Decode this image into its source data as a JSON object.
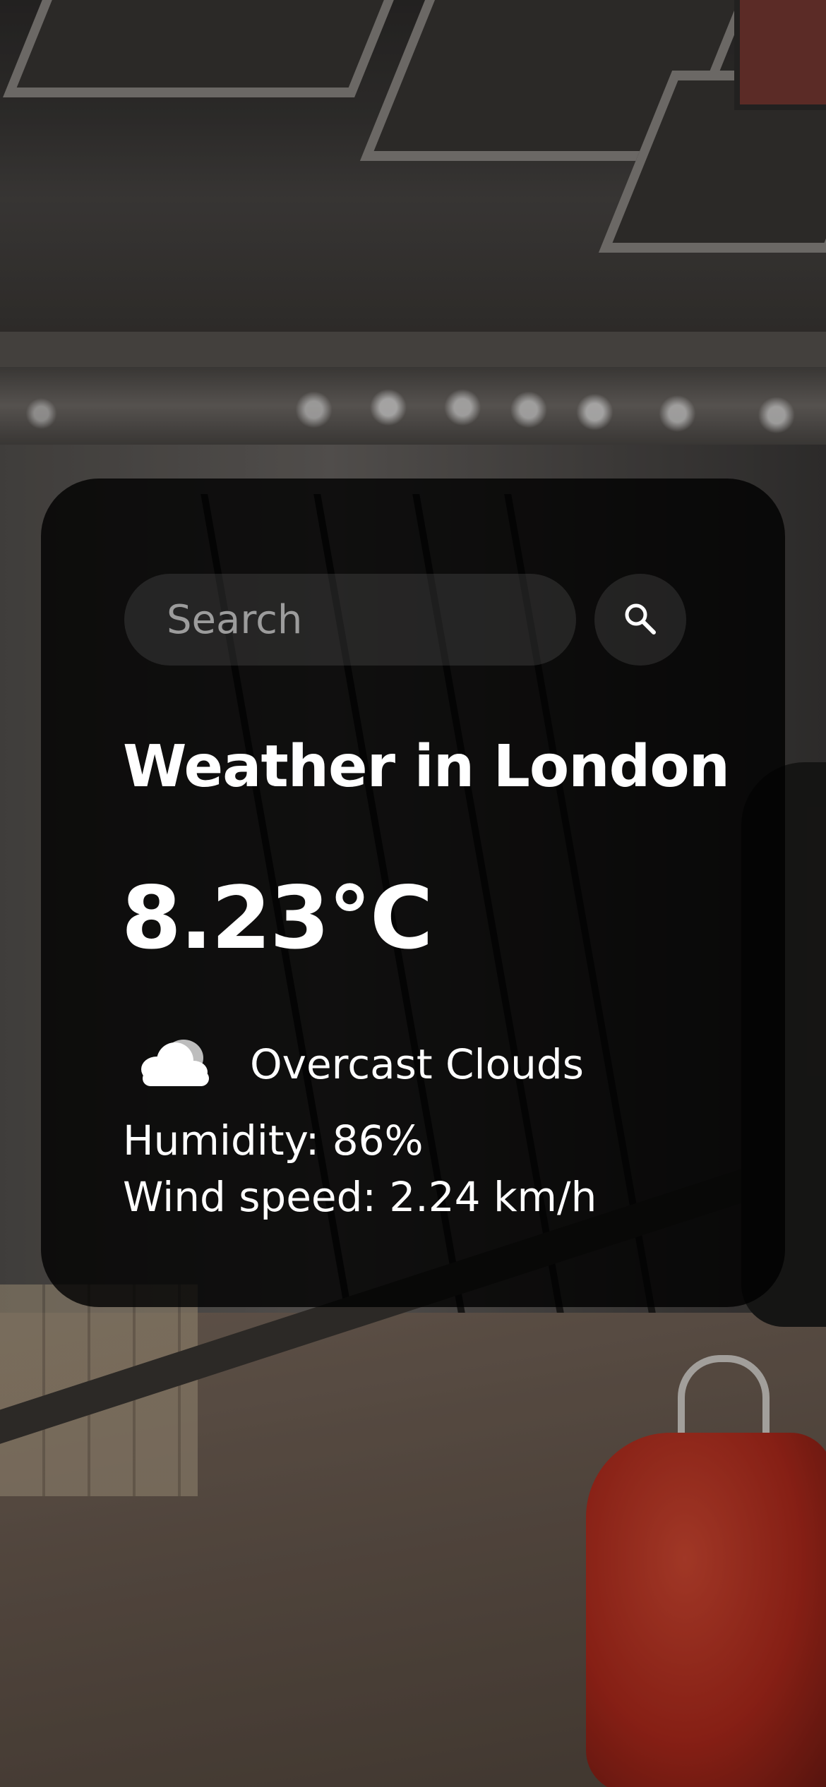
{
  "search": {
    "placeholder": "Search",
    "value": "",
    "button_icon": "search-icon"
  },
  "weather": {
    "title": "Weather in London",
    "temperature": "8.23°C",
    "condition": "Overcast Clouds",
    "condition_icon": "cloud-icon",
    "humidity": "Humidity: 86%",
    "wind_speed": "Wind speed: 2.24 km/h"
  },
  "colors": {
    "card_background": "#000000",
    "text": "#ffffff",
    "input_background": "#7d7d7d",
    "placeholder": "#9c9c9c"
  }
}
